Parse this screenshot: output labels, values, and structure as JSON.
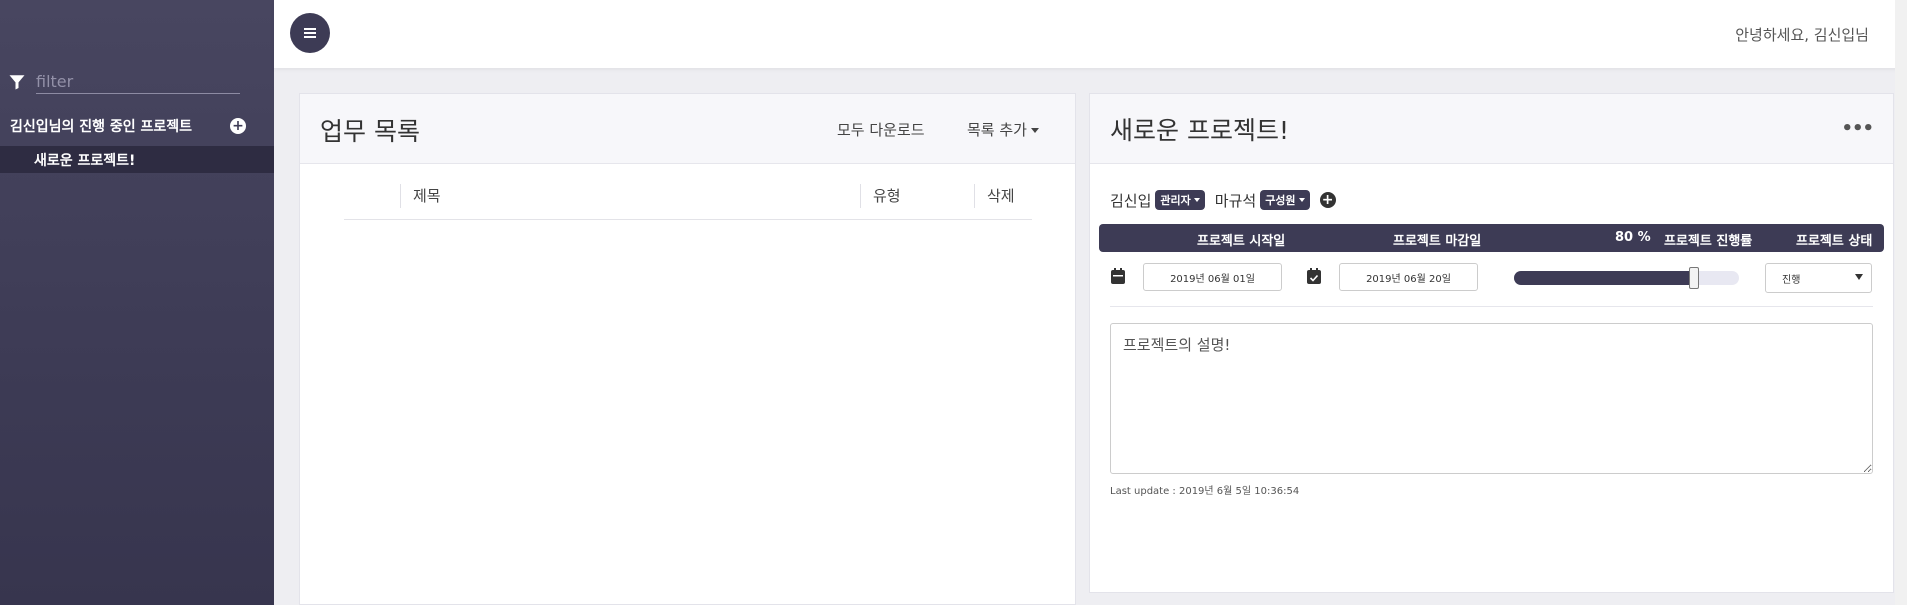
{
  "sidebar": {
    "filter_placeholder": "filter",
    "section_title": "김신입님의 진행 중인 프로젝트",
    "add_icon": "plus-circle-icon",
    "projects": [
      "새로운 프로젝트!"
    ]
  },
  "topbar": {
    "menu_icon": "hamburger-icon",
    "greeting": "안녕하세요, 김신입님"
  },
  "task_panel": {
    "title": "업무 목록",
    "download_all": "모두 다운로드",
    "add_list": "목록 추가",
    "columns": [
      "제목",
      "유형",
      "삭제"
    ]
  },
  "project_panel": {
    "title": "새로운 프로젝트!",
    "more_icon": "more-horizontal-icon",
    "members": [
      {
        "name": "김신입",
        "role": "관리자"
      },
      {
        "name": "마규석",
        "role": "구성원"
      }
    ],
    "add_member_icon": "plus-circle-icon",
    "headers": {
      "start_date": "프로젝트 시작일",
      "end_date": "프로젝트 마감일",
      "progress_value": "80 %",
      "progress_label": "프로젝트 진행률",
      "status": "프로젝트 상태"
    },
    "start_date": "2019년 06월 01일",
    "end_date": "2019년 06월 20일",
    "progress": 80,
    "status": "진행",
    "description": "프로젝트의 설명!",
    "last_update": "Last update : 2019년 6월 5일 10:36:54"
  },
  "colors": {
    "sidebar_bg": "#3d3b55",
    "accent": "#3d3b55",
    "page_bg": "#eeeef2"
  }
}
